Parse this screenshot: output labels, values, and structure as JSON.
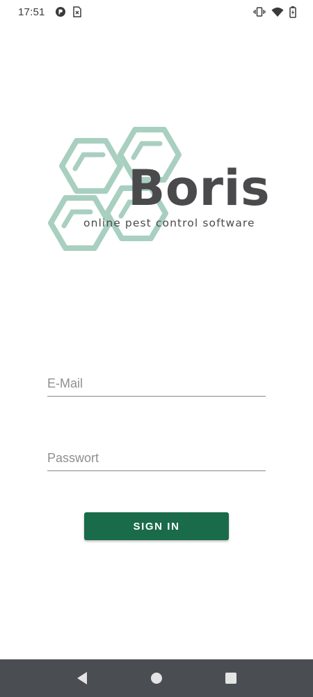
{
  "status_bar": {
    "time": "17:51",
    "left_icons": [
      "app-notification-icon",
      "sim-card-icon"
    ],
    "right_icons": [
      "vibrate-icon",
      "wifi-icon",
      "battery-charging-icon"
    ]
  },
  "logo": {
    "brand_name": "Boris",
    "tagline": "online pest control software",
    "hex_color": "#a8cfc0",
    "text_color": "#4a4a4c"
  },
  "form": {
    "email": {
      "placeholder": "E-Mail",
      "value": ""
    },
    "password": {
      "placeholder": "Passwort",
      "value": ""
    },
    "signin_label": "SIGN IN"
  },
  "nav_bar": {
    "buttons": [
      "back-icon",
      "home-icon",
      "recents-icon"
    ]
  },
  "colors": {
    "accent": "#1a6b4a",
    "nav_background": "#4a4d52"
  }
}
